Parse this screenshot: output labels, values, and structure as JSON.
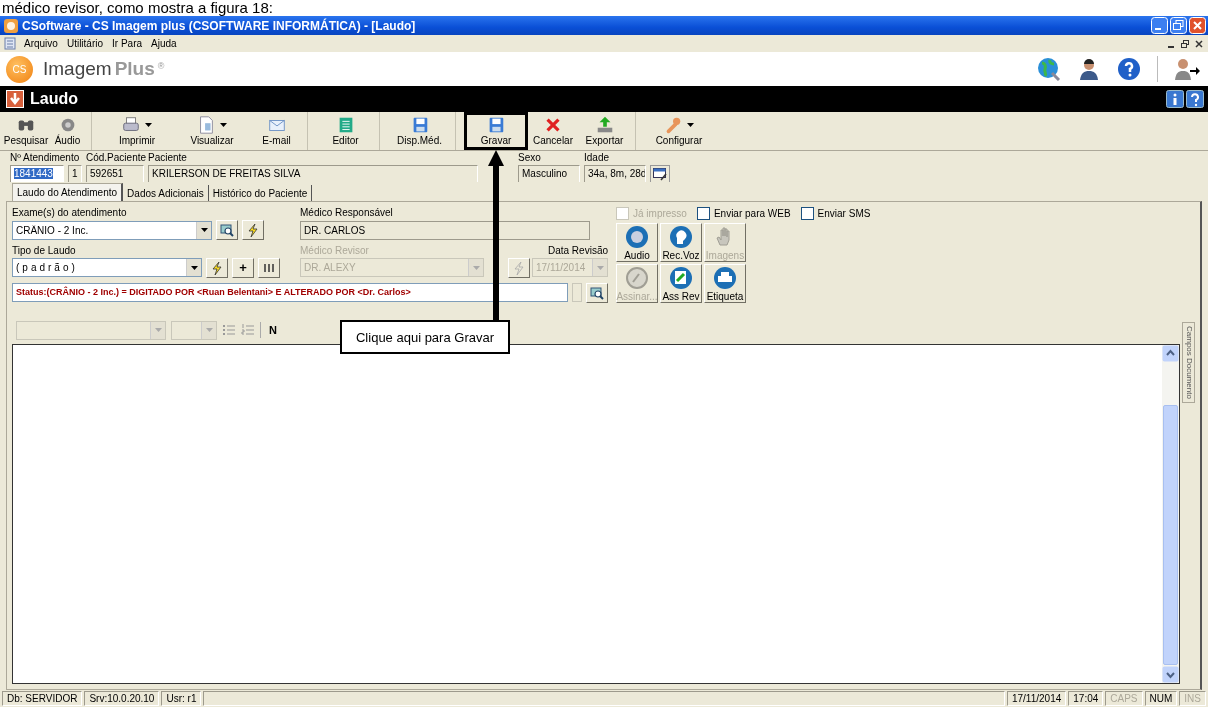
{
  "caption": "médico revisor, como mostra a figura 18:",
  "window": {
    "title": "CSoftware - CS Imagem plus (CSOFTWARE INFORMÁTICA) - [Laudo]"
  },
  "menu": [
    {
      "label": "Arquivo"
    },
    {
      "label": "Utilitário"
    },
    {
      "label": "Ir Para"
    },
    {
      "label": "Ajuda"
    }
  ],
  "brand": {
    "logo": "CS",
    "name": "Imagem",
    "suffix": "Plus",
    "mark": "®"
  },
  "form_title": "Laudo",
  "toolbar": [
    {
      "label": "Pesquisar",
      "kind": "binoculars",
      "dropdown": false,
      "separator": false,
      "highlighted": false
    },
    {
      "label": "Áudio",
      "kind": "speaker",
      "dropdown": false,
      "separator": true,
      "highlighted": false
    },
    {
      "label": "Imprimir",
      "kind": "printer",
      "dropdown": true,
      "separator": false,
      "highlighted": false
    },
    {
      "label": "Visualizar",
      "kind": "page",
      "dropdown": true,
      "separator": false,
      "highlighted": false
    },
    {
      "label": "E-mail",
      "kind": "envelope",
      "dropdown": false,
      "separator": true,
      "highlighted": false
    },
    {
      "label": "Editor",
      "kind": "editor",
      "dropdown": false,
      "separator": true,
      "highlighted": false
    },
    {
      "label": "Disp.Méd.",
      "kind": "floppy",
      "dropdown": false,
      "separator": true,
      "highlighted": false
    },
    {
      "label": "Gravar",
      "kind": "floppy",
      "dropdown": false,
      "separator": false,
      "highlighted": true
    },
    {
      "label": "Cancelar",
      "kind": "cross",
      "dropdown": false,
      "separator": false,
      "highlighted": false
    },
    {
      "label": "Exportar",
      "kind": "export",
      "dropdown": false,
      "separator": true,
      "highlighted": false
    },
    {
      "label": "Configurar",
      "kind": "wrench",
      "dropdown": true,
      "separator": false,
      "highlighted": false
    }
  ],
  "patient": [
    {
      "label": "Nº Atendimento",
      "value": "1841443",
      "selected": true
    },
    {
      "value": "1",
      "selected": false
    },
    {
      "label": "Cód.Paciente",
      "value": "592651",
      "selected": false
    },
    {
      "label": "Paciente",
      "value": "KRILERSON DE FREITAS SILVA",
      "selected": false
    },
    {
      "label": "Sexo",
      "value": "Masculino",
      "selected": false
    },
    {
      "label": "Idade",
      "value": "34a, 8m, 28d",
      "selected": false
    }
  ],
  "tabs": [
    {
      "label": "Laudo do Atendimento",
      "selected": true
    },
    {
      "label": "Dados Adicionais",
      "selected": false
    },
    {
      "label": "Histórico do Paciente",
      "selected": false
    }
  ],
  "form": {
    "exam": {
      "label": "Exame(s) do atendimento",
      "value": "CRÂNIO - 2 Inc."
    },
    "doctor": {
      "label": "Médico Responsável",
      "value": "DR. CARLOS"
    },
    "report_type": {
      "label": "Tipo de Laudo",
      "value": "(padrão)",
      "add_button": "+"
    },
    "reviewer": {
      "label": "Médico Revisor",
      "value": "DR. ALEXY",
      "disabled": true
    },
    "review_date": {
      "label": "Data Revisão",
      "value": "17/11/2014",
      "disabled": true
    },
    "status": "Status:(CRÂNIO - 2 Inc.) = DIGITADO POR <Ruan Belentani>  E ALTERADO POR <Dr. Carlos>",
    "checkboxes": [
      {
        "label": "Já impresso",
        "checked": false,
        "disabled": true
      },
      {
        "label": "Enviar para WEB",
        "checked": false,
        "disabled": false
      },
      {
        "label": "Enviar SMS",
        "checked": false,
        "disabled": false
      }
    ],
    "actions": [
      {
        "label": "Audio",
        "kind": "disc",
        "disabled": false
      },
      {
        "label": "Rec.Voz",
        "kind": "head",
        "disabled": false
      },
      {
        "label": "Imagens",
        "kind": "hand",
        "disabled": true
      },
      {
        "label": "Assinar...",
        "kind": "seal",
        "disabled": true
      },
      {
        "label": "Ass Rev",
        "kind": "pen",
        "disabled": false
      },
      {
        "label": "Etiqueta",
        "kind": "printer",
        "disabled": false
      }
    ]
  },
  "editor": {
    "bold_button": "N",
    "side_tab": "Campos Documento"
  },
  "callout": "Clique aqui para Gravar",
  "status_bar": {
    "left": [
      {
        "text": "Db: SERVIDOR",
        "disabled": false
      },
      {
        "text": "Srv:10.0.20.10",
        "disabled": false
      },
      {
        "text": "Usr: r1",
        "disabled": false
      }
    ],
    "right": [
      {
        "text": "17/11/2014",
        "disabled": false
      },
      {
        "text": "17:04",
        "disabled": false
      },
      {
        "text": "CAPS",
        "disabled": true
      },
      {
        "text": "NUM",
        "disabled": false
      },
      {
        "text": "INS",
        "disabled": true
      }
    ]
  }
}
